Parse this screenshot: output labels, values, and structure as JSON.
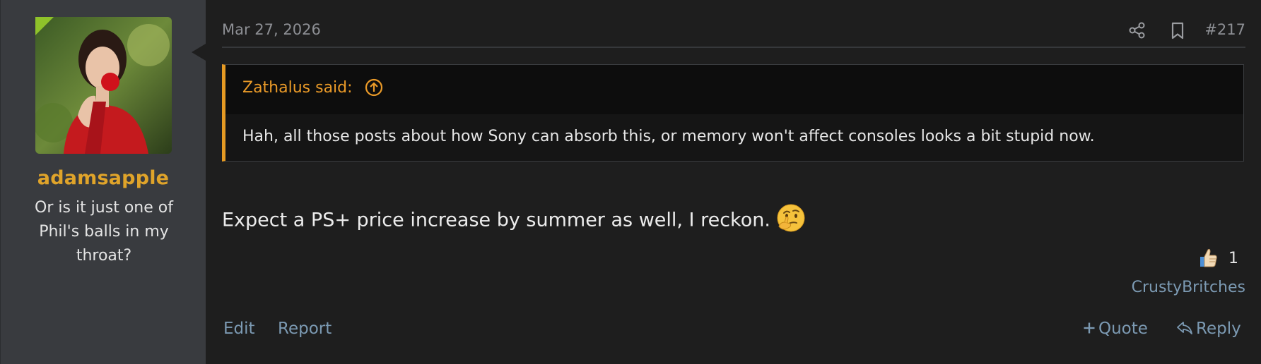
{
  "author": {
    "username": "adamsapple",
    "user_title": "Or is it just one of Phil's balls in my throat?",
    "avatar_icon": "avatar-photo"
  },
  "post": {
    "date": "Mar 27, 2026",
    "number": "#217",
    "quote": {
      "author_label": "Zathalus said:",
      "text": "Hah, all those posts about how Sony can absorb this, or memory won't affect consoles looks a bit stupid now."
    },
    "message": "Expect a PS+ price increase by summer as well, I reckon.",
    "message_emoji": "thinking-face-icon",
    "reactions": {
      "icon": "thumbs-up-icon",
      "count": "1",
      "users": "CrustyBritches"
    },
    "actions": {
      "edit": "Edit",
      "report": "Report",
      "quote": "Quote",
      "reply": "Reply"
    }
  },
  "colors": {
    "accent_username": "#e0a42a",
    "quote_border": "#e59a23",
    "link": "#7c9ab3",
    "background": "#1e1e1e",
    "user_cell": "#393b3f"
  }
}
